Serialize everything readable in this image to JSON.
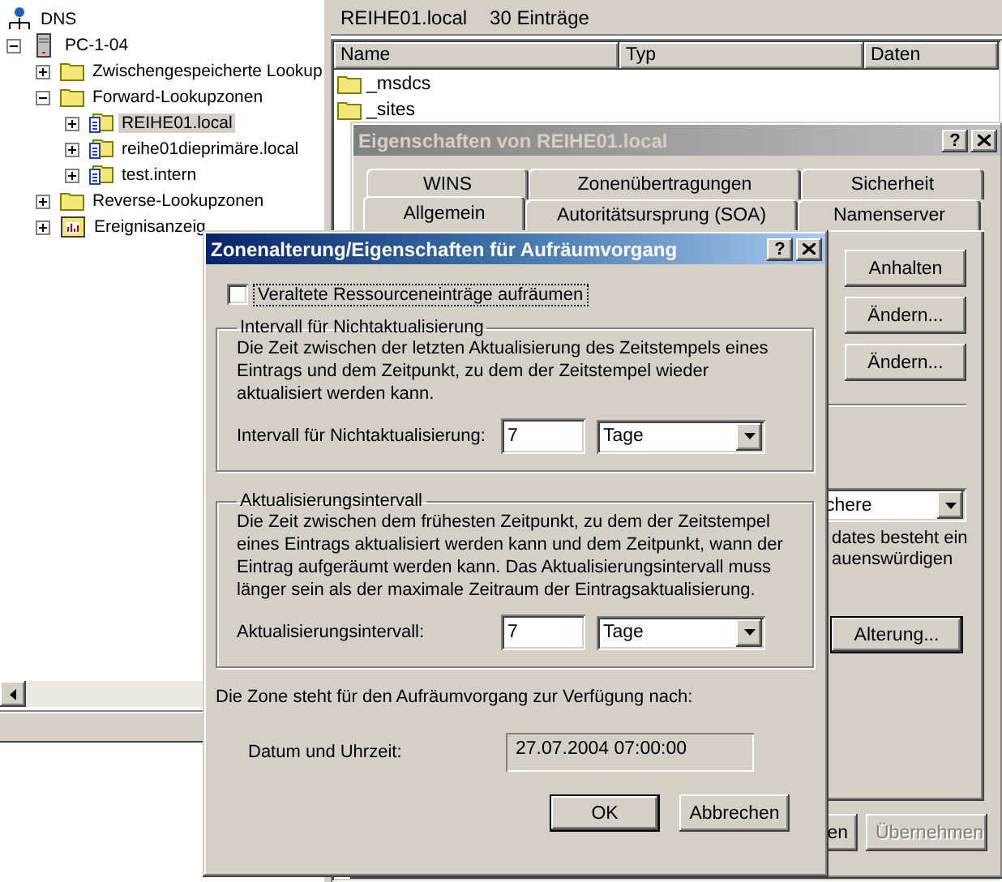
{
  "tree": [
    {
      "label": "DNS",
      "kind": "network",
      "selected": false,
      "children": [
        {
          "label": "PC-1-04",
          "kind": "server",
          "expanded": true,
          "selected": false,
          "children": [
            {
              "label": "Zwischengespeicherte Lookup",
              "kind": "folder",
              "expanded": false,
              "selected": false
            },
            {
              "label": "Forward-Lookupzonen",
              "kind": "folder",
              "expanded": true,
              "selected": false,
              "children": [
                {
                  "label": "REIHE01.local",
                  "kind": "zone",
                  "expanded": false,
                  "selected": true
                },
                {
                  "label": "reihe01dieprimäre.local",
                  "kind": "zone",
                  "expanded": false,
                  "selected": false
                },
                {
                  "label": "test.intern",
                  "kind": "zone",
                  "expanded": false,
                  "selected": false
                }
              ]
            },
            {
              "label": "Reverse-Lookupzonen",
              "kind": "folder",
              "expanded": false,
              "selected": false
            },
            {
              "label": "Ereignisanzeig",
              "kind": "log",
              "expanded": false,
              "selected": false
            }
          ]
        }
      ]
    }
  ],
  "list": {
    "zone": "REIHE01.local",
    "count": "30 Einträge",
    "columns": [
      "Name",
      "Typ",
      "Daten"
    ],
    "rows": [
      {
        "name": "_msdcs"
      },
      {
        "name": "_sites"
      }
    ]
  },
  "properties_window": {
    "title": "Eigenschaften von REIHE01.local",
    "active": false,
    "help_button": "?",
    "tab_rows": [
      [
        {
          "label": "WINS",
          "selected": false
        },
        {
          "label": "Zonenübertragungen",
          "selected": false
        },
        {
          "label": "Sicherheit",
          "selected": false
        }
      ],
      [
        {
          "label": "Allgemein",
          "selected": true
        },
        {
          "label": "Autoritätsursprung (SOA)",
          "selected": false
        },
        {
          "label": "Namenserver",
          "selected": false
        }
      ]
    ],
    "buttons": [
      "Anhalten",
      "Ändern...",
      "Ändern..."
    ],
    "dropdown_value": "chere",
    "note_lines": [
      "dates besteht ein",
      "auenswürdigen"
    ],
    "aging_button": "Alterung...",
    "footer_buttons": [
      {
        "label": "en",
        "disabled": false
      },
      {
        "label": "Übernehmen",
        "disabled": true
      }
    ]
  },
  "aging_dialog": {
    "title": "Zonenalterung/Eigenschaften für Aufräumvorgang",
    "active": true,
    "help_button": "?",
    "checkbox": {
      "label": "Veraltete Ressourceneinträge aufräumen",
      "checked": false
    },
    "groups": [
      {
        "legend": "Intervall für Nichtaktualisierung",
        "description": "Die Zeit zwischen der letzten Aktualisierung des Zeitstempels eines Eintrags und dem Zeitpunkt, zu dem der Zeitstempel wieder aktualisiert werden kann.",
        "field_label": "Intervall für Nichtaktualisierung:",
        "value": "7",
        "unit": "Tage"
      },
      {
        "legend": "Aktualisierungsintervall",
        "description": "Die Zeit zwischen dem frühesten Zeitpunkt, zu dem der Zeitstempel eines Eintrags aktualisiert werden kann und dem Zeitpunkt, wann der Eintrag aufgeräumt werden kann. Das Aktualisierungsintervall muss länger sein als der maximale Zeitraum der Eintragsaktualisierung.",
        "field_label": "Aktualisierungsintervall:",
        "value": "7",
        "unit": "Tage"
      }
    ],
    "availability_text": "Die Zone steht für den Aufräumvorgang zur Verfügung nach:",
    "date_label": "Datum und Uhrzeit:",
    "date_value": "27.07.2004 07:00:00",
    "buttons": [
      {
        "label": "OK",
        "default": true
      },
      {
        "label": "Abbrechen",
        "default": false
      }
    ]
  }
}
